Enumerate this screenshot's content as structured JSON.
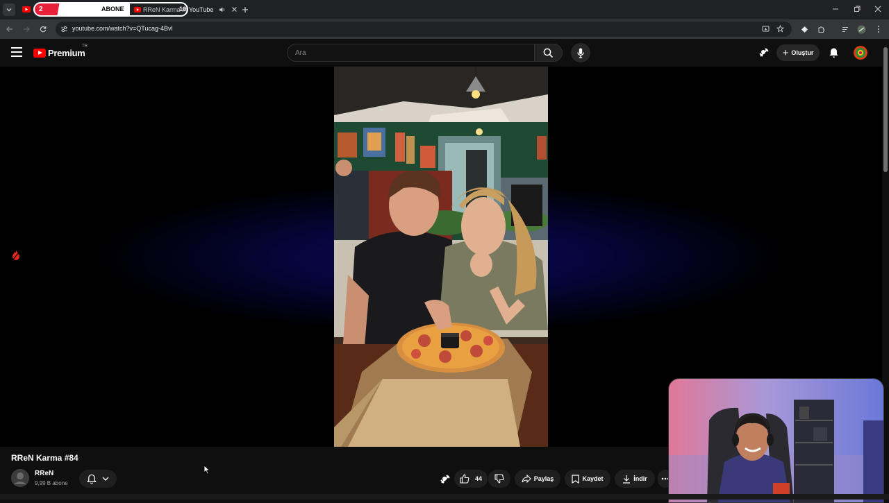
{
  "browser": {
    "overlay_tab_number": "2",
    "overlay_label": "ABONE",
    "active_tab_title": "RReN Karma #84",
    "active_tab_counter": "10",
    "active_tab_site": "YouTube",
    "url": "youtube.com/watch?v=QTucag-4Bvl"
  },
  "youtube": {
    "logo_text": "Premium",
    "region": "TR",
    "search_placeholder": "Ara",
    "create_label": "Oluştur"
  },
  "video": {
    "title": "RReN Karma #84",
    "channel_name": "RReN",
    "subscribers": "9,99 B abone",
    "like_count": "44",
    "share_label": "Paylaş",
    "save_label": "Kaydet",
    "download_label": "İndir"
  },
  "colors": {
    "accent": "#ff0000",
    "background": "#0f0f0f",
    "player_glow": "#0a0a5a"
  }
}
